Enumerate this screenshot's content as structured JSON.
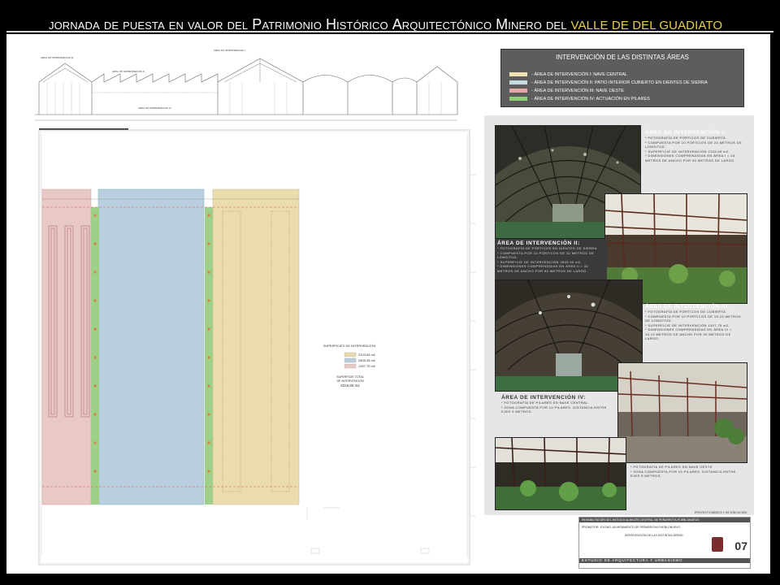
{
  "header": {
    "title_words": [
      {
        "text": "JORNADA",
        "style": "normal"
      },
      {
        "text": "DE",
        "style": "normal"
      },
      {
        "text": "PUESTA",
        "style": "normal"
      },
      {
        "text": "EN",
        "style": "normal"
      },
      {
        "text": "VALOR",
        "style": "normal"
      },
      {
        "text": "DEL",
        "style": "normal"
      },
      {
        "text": "P",
        "style": "big",
        "cont": "ATRIMONIO"
      },
      {
        "text": "H",
        "style": "big",
        "cont": "ISTÓRICO"
      },
      {
        "text": "A",
        "style": "big",
        "cont": "RQUITECTÓNICO"
      },
      {
        "text": "M",
        "style": "big",
        "cont": "INERO"
      },
      {
        "text": "DEL",
        "style": "normal"
      },
      {
        "text": "VALLE DE DEL GUADIATO",
        "style": "hl"
      }
    ]
  },
  "section": {
    "labels": [
      "ÁREA DE INTERVENCIÓN III",
      "ÁREA DE INTERVENCIÓN I",
      "ÁREA DE INTERVENCIÓN II",
      "ÁREA DE INTERVENCIÓN IV"
    ]
  },
  "legend": {
    "title": "INTERVENCIÓN DE LAS DISTINTAS  ÁREAS",
    "items": [
      {
        "label": "- ÁREA DE INTERVENCIÓN  I:  NAVE CENTRAL",
        "color": "#f2e3b0"
      },
      {
        "label": "- ÁREA DE INTERVENCIÓN  II:  PATIO INTERIOR CUBIERTO EN DIENTES DE SIERRA",
        "color": "#c7dbe3"
      },
      {
        "label": "- ÁREA DE INTERVENCIÓN  III:  NAVE OESTE",
        "color": "#e3a8a8"
      },
      {
        "label": "- ÁREA DE INTERVENCIÓN  IV:  ACTUACIÓN EN PILARES",
        "color": "#8fcf7a"
      }
    ]
  },
  "plan": {
    "colors": {
      "nave_oeste": "#e8c9c6",
      "pilares": "#9fd08a",
      "patio": "#b9cfdf",
      "nave_central": "#eadcad"
    },
    "surfaces": {
      "title": "SUPERFICIES DE INTERVENCIÓN",
      "items": [
        {
          "value": "2103.65 m2",
          "color": "#eadcad"
        },
        {
          "value": "2805.45 m2",
          "color": "#b9cfdf"
        },
        {
          "value": "1307.75 m2",
          "color": "#e8c9c6"
        }
      ],
      "total_label_1": "SUPERFICIE TOTAL",
      "total_label_2": "DE INTERVENCIÓN",
      "total_value": "6216.85 m2"
    }
  },
  "photos": {
    "area1": {
      "title": "ÁREA DE INTERVENCIÓN I:",
      "lines": [
        "* FOTOGRAFÍA DE PÓRTICOS DE CUBIERTA",
        "* COMPUESTA POR 10 PÓRTICOS DE 24 METROS DE LONGITUD.",
        "* SUPERFICIE DE INTERVENCIÓN 2103.65 m2.",
        "* DIMENSIONES COMPRENDIDAS EN ÁREA I = 24 METROS DE ANCHO POR 90 METROS DE LARGO."
      ]
    },
    "area2": {
      "title": "ÁREA DE INTERVENCIÓN II:",
      "lines": [
        "* FOTOGRAFÍA DE PÓRTICOS EN DIENTES DE SIERRA",
        "* COMPUESTA POR 10 PÓRTICOS DE 32 METROS DE LONGITUD.",
        "* SUPERFICIE DE INTERVENCIÓN 2805.45 m2.",
        "* DIMENSIONES COMPRENDIDAS EN ÁREA II = 32 METROS DE ANCHO POR 90 METROS DE LARGO."
      ]
    },
    "area3": {
      "title": "ÁREA DE INTERVENCIÓN III:",
      "lines": [
        "* FOTOGRAFÍA DE PÓRTICOS DE CUBIERTA",
        "* COMPUESTA POR 10 PÓRTICOS DE 15.15 METROS DE LONGITUD.",
        "* SUPERFICIE DE INTERVENCIÓN 1307.75 m2.",
        "* DIMENSIONES COMPRENDIDAS EN ÁREA III = 15.15 METROS DE ANCHO POR 90 METROS DE LARGO."
      ]
    },
    "area4": {
      "title": "ÁREA DE INTERVENCIÓN IV:",
      "lines": [
        "* FOTOGRAFÍA DE PILARES EN NAVE CENTRAL.",
        "* ZONA COMPUESTA POR 10 PILARES. DISTANCIA ENTRE EJES 9 METROS."
      ]
    },
    "area4b": {
      "lines": [
        "* FOTOGRAFÍA DE PILARES EN NAVE OESTE",
        "* ZONA COMPUESTA POR 10 PILARES. DISTANCIA ENTRE EJES 9 METROS."
      ]
    }
  },
  "title_block": {
    "phase": "PROYECTO BÁSICO Y DE EJECUCIÓN",
    "project": "REHABILITACIÓN DEL ANTIGUO ALMACÉN CENTRAL DE PEÑARROYA-PUEBLONUEVO",
    "promoter_label": "PROMOTOR",
    "promoter": "EXCMO. AYUNTAMIENTO DE PEÑARROYA-PUEBLONUEVO",
    "sheet_title": "INTERVENCIÓN DE LAS DISTINTAS ÁREAS",
    "sheet_number": "07",
    "studio": "ESTUDIO DE ARQUITECTURA Y URBANISMO"
  }
}
